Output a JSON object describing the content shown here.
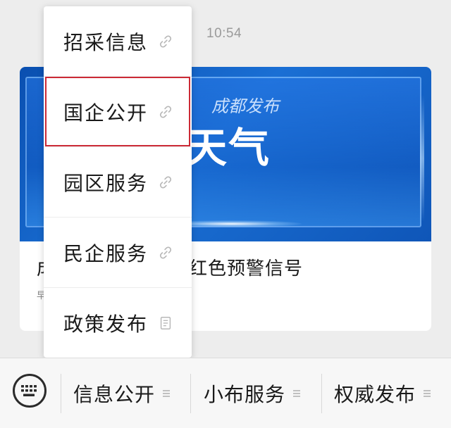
{
  "chat": {
    "timestamp": "10:54"
  },
  "article": {
    "banner_brand": "成都发布",
    "banner_title": "天气",
    "title": "成都发布最早高温红色预警信号",
    "meta": "早高温"
  },
  "menu": {
    "selected_index": 1,
    "items": [
      {
        "label": "招采信息",
        "icon": "link-icon"
      },
      {
        "label": "国企公开",
        "icon": "link-icon"
      },
      {
        "label": "园区服务",
        "icon": "link-icon"
      },
      {
        "label": "民企服务",
        "icon": "link-icon"
      },
      {
        "label": "政策发布",
        "icon": "document-icon"
      }
    ]
  },
  "bottom_bar": {
    "keyboard_icon": "keyboard-icon",
    "tabs": [
      {
        "label": "信息公开",
        "icon": "menu-lines-icon"
      },
      {
        "label": "小布服务",
        "icon": "menu-lines-icon"
      },
      {
        "label": "权威发布",
        "icon": "menu-lines-icon"
      }
    ]
  },
  "colors": {
    "highlight_border": "#cc2a36",
    "banner_blue": "#0a4fb0",
    "background": "#ededed"
  }
}
